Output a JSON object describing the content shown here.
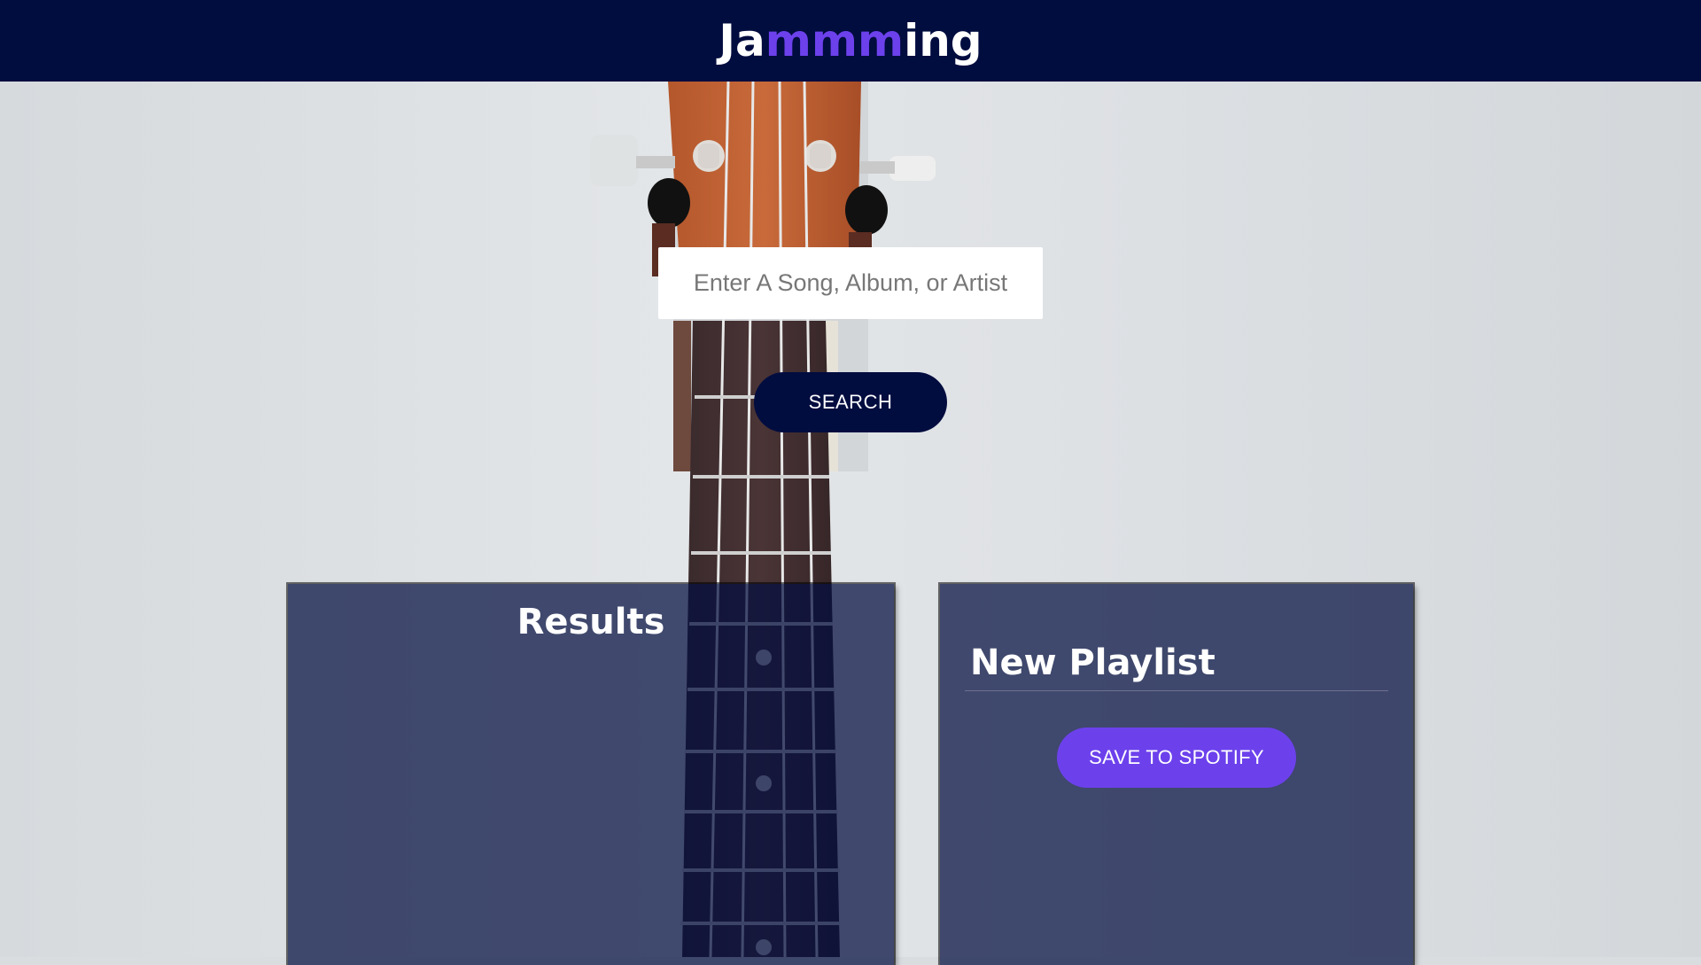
{
  "header": {
    "logo_prefix": "Ja",
    "logo_accent": "mmm",
    "logo_suffix": "ing"
  },
  "search": {
    "placeholder": "Enter A Song, Album, or Artist",
    "value": "",
    "button_label": "SEARCH"
  },
  "results": {
    "title": "Results",
    "tracks": []
  },
  "playlist": {
    "name": "New Playlist",
    "tracks": [],
    "save_label": "SAVE TO SPOTIFY"
  },
  "colors": {
    "header_bg": "#010c3f",
    "accent": "#6c41ec",
    "panel_bg": "#010c3f"
  },
  "background": {
    "image": "ukulele-headstock-on-wall"
  }
}
